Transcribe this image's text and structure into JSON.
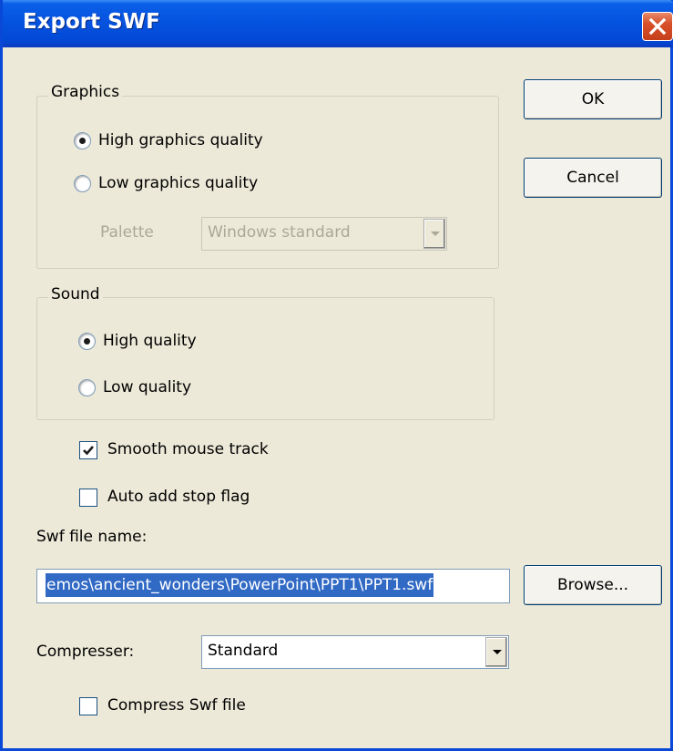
{
  "window": {
    "title": "Export SWF"
  },
  "buttons": {
    "ok": "OK",
    "cancel": "Cancel",
    "browse": "Browse..."
  },
  "graphics": {
    "label": "Graphics",
    "high": {
      "label": "High graphics quality",
      "checked": true
    },
    "low": {
      "label": "Low graphics quality",
      "checked": false
    },
    "palette": {
      "label": "Palette",
      "value": "Windows standard",
      "enabled": false
    }
  },
  "sound": {
    "label": "Sound",
    "high": {
      "label": "High quality",
      "checked": true
    },
    "low": {
      "label": "Low quality",
      "checked": false
    }
  },
  "options": {
    "smooth_mouse": {
      "label": "Smooth mouse track",
      "checked": true
    },
    "auto_stop": {
      "label": "Auto add stop flag",
      "checked": false
    },
    "compress_swf": {
      "label": "Compress Swf file",
      "checked": false
    }
  },
  "file": {
    "label": "Swf file name:",
    "value": "emos\\ancient_wonders\\PowerPoint\\PPT1\\PPT1.swf"
  },
  "compressor": {
    "label": "Compresser:",
    "value": "Standard"
  },
  "icons": {
    "close": "close-icon",
    "dropdown": "chevron-down-icon",
    "check": "checkmark-icon"
  },
  "colors": {
    "titlebar": "#0553e0",
    "close": "#d8502a",
    "selection": "#316ac5",
    "dialog": "#ece9d8"
  }
}
